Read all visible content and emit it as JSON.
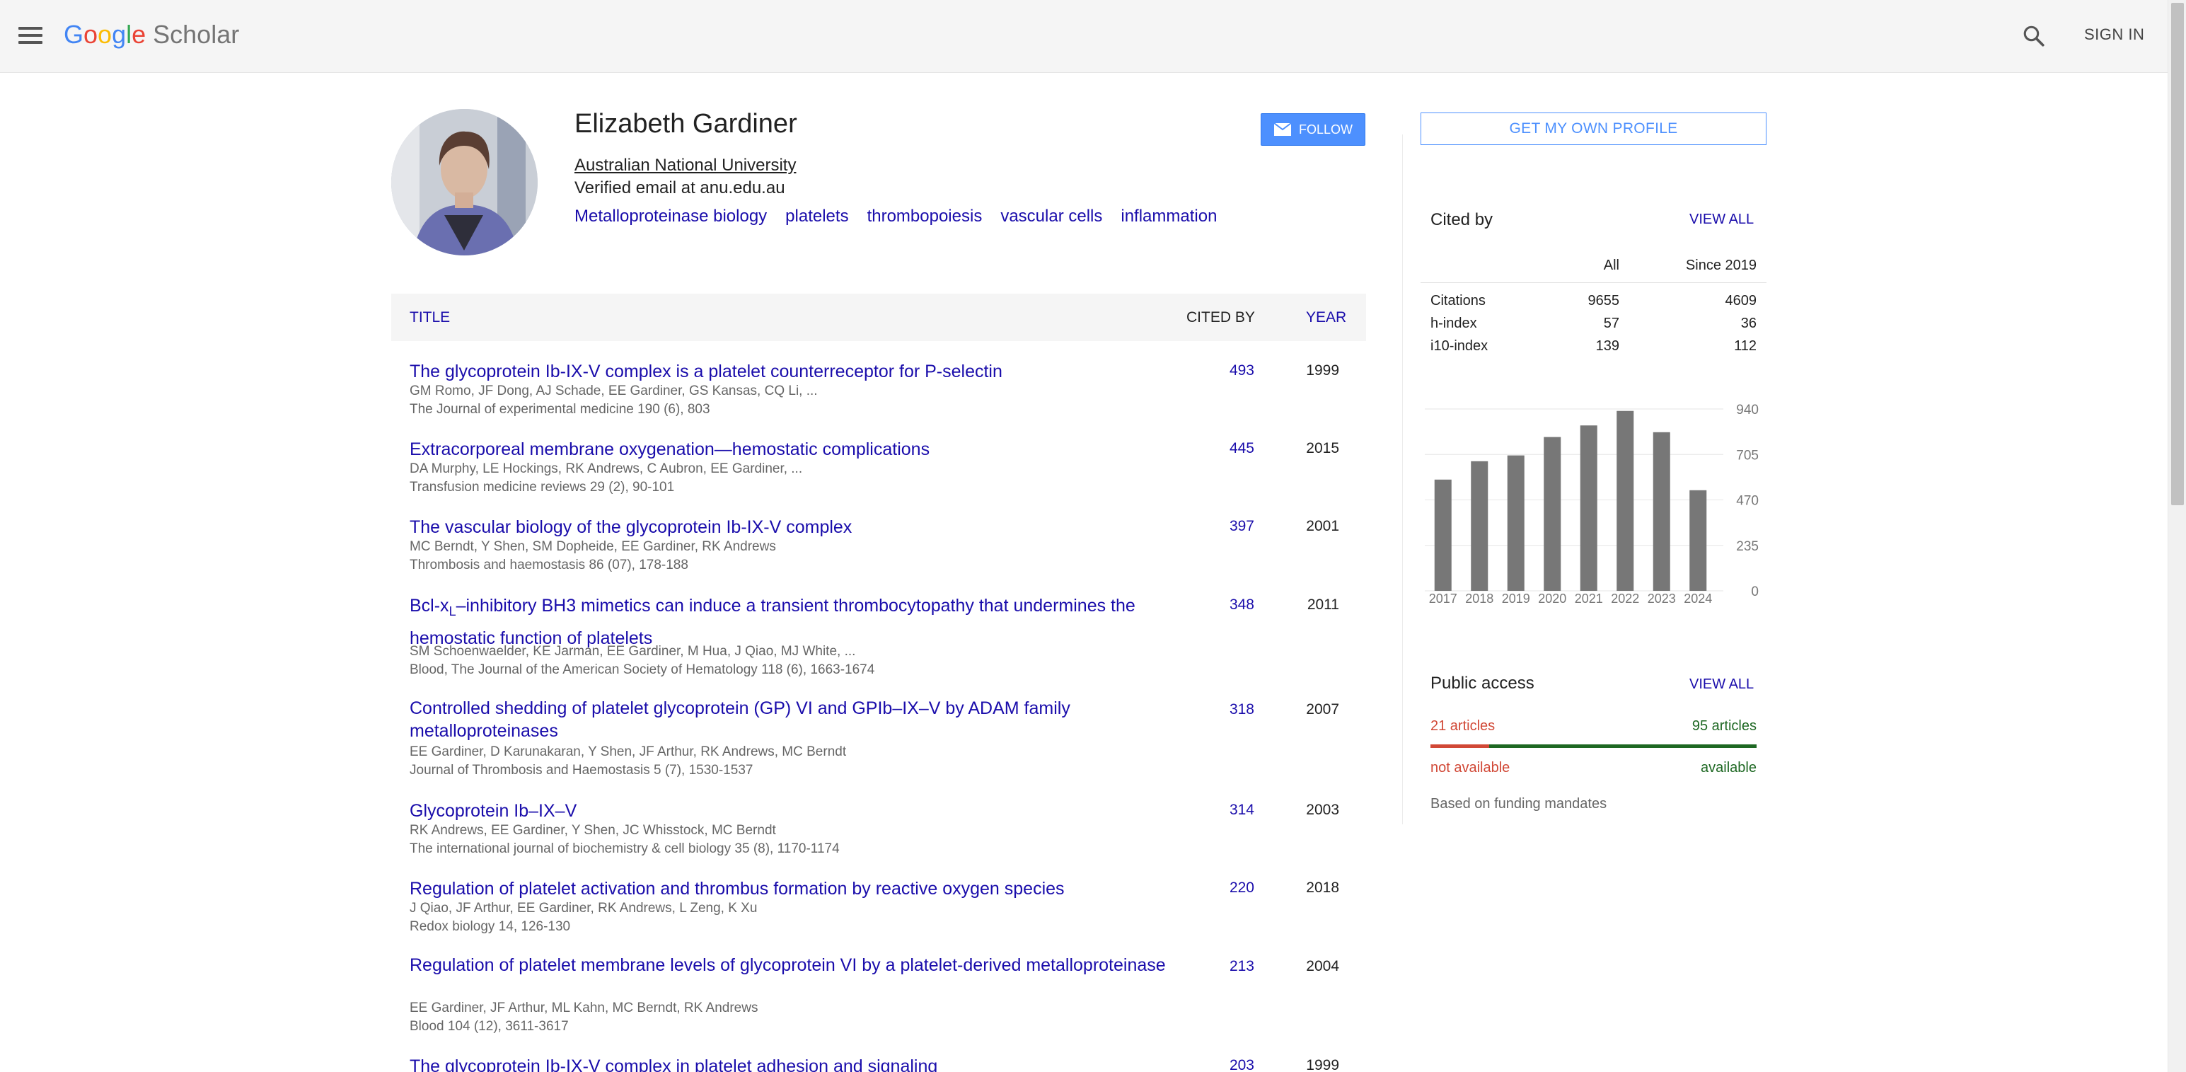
{
  "header": {
    "logo_letters": [
      "G",
      "o",
      "o",
      "g",
      "l",
      "e"
    ],
    "logo_suffix": "Scholar",
    "sign_in": "SIGN IN"
  },
  "profile": {
    "name": "Elizabeth Gardiner",
    "affiliation": "Australian National University",
    "email": "Verified email at anu.edu.au",
    "interests": [
      "Metalloproteinase biology",
      "platelets",
      "thrombopoiesis",
      "vascular cells",
      "inflammation"
    ],
    "follow_label": "FOLLOW"
  },
  "table": {
    "col_title": "TITLE",
    "col_cited": "CITED BY",
    "col_year": "YEAR",
    "rows": [
      {
        "title": "The glycoprotein Ib-IX-V complex is a platelet counterreceptor for P-selectin",
        "authors": "GM Romo, JF Dong, AJ Schade, EE Gardiner, GS Kansas, CQ Li, ...",
        "venue": "The Journal of experimental medicine 190 (6), 803",
        "cites": "493",
        "year": "1999"
      },
      {
        "title": "Extracorporeal membrane oxygenation—hemostatic complications",
        "authors": "DA Murphy, LE Hockings, RK Andrews, C Aubron, EE Gardiner, ...",
        "venue": "Transfusion medicine reviews 29 (2), 90-101",
        "cites": "445",
        "year": "2015"
      },
      {
        "title": "The vascular biology of the glycoprotein Ib-IX-V complex",
        "authors": "MC Berndt, Y Shen, SM Dopheide, EE Gardiner, RK Andrews",
        "venue": "Thrombosis and haemostasis 86 (07), 178-188",
        "cites": "397",
        "year": "2001"
      },
      {
        "title_prefix": "Bcl-x",
        "title_sub": "L",
        "title_rest": "–inhibitory BH3 mimetics can induce a transient thrombocytopathy that undermines the hemostatic function of platelets",
        "authors": "SM Schoenwaelder, KE Jarman, EE Gardiner, M Hua, J Qiao, MJ White, ...",
        "venue": "Blood, The Journal of the American Society of Hematology 118 (6), 1663-1674",
        "cites": "348",
        "year": "2011"
      },
      {
        "title": "Controlled shedding of platelet glycoprotein (GP) VI and GPIb–IX–V by ADAM family metalloproteinases",
        "authors": "EE Gardiner, D Karunakaran, Y Shen, JF Arthur, RK Andrews, MC Berndt",
        "venue": "Journal of Thrombosis and Haemostasis 5 (7), 1530-1537",
        "cites": "318",
        "year": "2007"
      },
      {
        "title": "Glycoprotein Ib–IX–V",
        "authors": "RK Andrews, EE Gardiner, Y Shen, JC Whisstock, MC Berndt",
        "venue": "The international journal of biochemistry & cell biology 35 (8), 1170-1174",
        "cites": "314",
        "year": "2003"
      },
      {
        "title": "Regulation of platelet activation and thrombus formation by reactive oxygen species",
        "authors": "J Qiao, JF Arthur, EE Gardiner, RK Andrews, L Zeng, K Xu",
        "venue": "Redox biology 14, 126-130",
        "cites": "220",
        "year": "2018"
      },
      {
        "title": "Regulation of platelet membrane levels of glycoprotein VI by a platelet-derived metalloproteinase",
        "authors": "EE Gardiner, JF Arthur, ML Kahn, MC Berndt, RK Andrews",
        "venue": "Blood 104 (12), 3611-3617",
        "cites": "213",
        "year": "2004"
      },
      {
        "title": "The glycoprotein Ib-IX-V complex in platelet adhesion and signaling",
        "cites": "203",
        "year": "1999"
      }
    ]
  },
  "sidebar": {
    "own_profile": "GET MY OWN PROFILE",
    "cited_by": {
      "heading": "Cited by",
      "view_all": "VIEW ALL",
      "col_all": "All",
      "col_since": "Since 2019",
      "rows": [
        {
          "label": "Citations",
          "all": "9655",
          "since": "4609"
        },
        {
          "label": "h-index",
          "all": "57",
          "since": "36"
        },
        {
          "label": "i10-index",
          "all": "139",
          "since": "112"
        }
      ]
    },
    "public_access": {
      "heading": "Public access",
      "view_all": "VIEW ALL",
      "not_available_count": "21 articles",
      "available_count": "95 articles",
      "not_available_fraction": 0.181,
      "not_available_label": "not available",
      "available_label": "available",
      "note": "Based on funding mandates"
    }
  },
  "chart_data": {
    "type": "bar",
    "categories": [
      "2017",
      "2018",
      "2019",
      "2020",
      "2021",
      "2022",
      "2023",
      "2024"
    ],
    "values": [
      575,
      670,
      700,
      795,
      855,
      930,
      820,
      520
    ],
    "ylim": [
      0,
      940
    ],
    "yticks": [
      "0",
      "235",
      "470",
      "705",
      "940"
    ],
    "bar_color": "#777777",
    "grid": true
  },
  "colors": {
    "link": "#1a0dab",
    "accent_blue": "#4d90fe",
    "not_available": "#d14836",
    "available": "#1e6823"
  }
}
